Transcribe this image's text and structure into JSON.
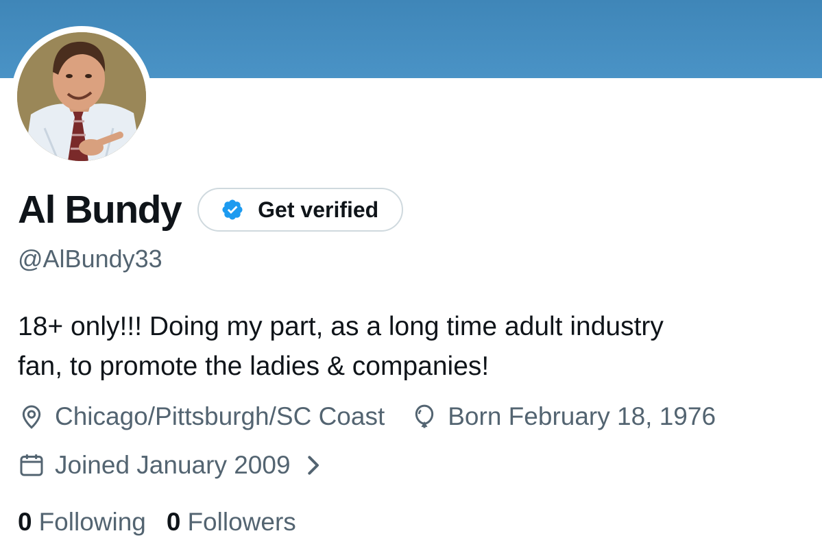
{
  "profile": {
    "display_name": "Al Bundy",
    "handle": "@AlBundy33",
    "bio_line1": "18+ only!!! Doing my part, as a long time adult industry",
    "bio_line2": "fan, to promote the ladies & companies!",
    "location": "Chicago/Pittsburgh/SC Coast",
    "birthday": "Born February 18, 1976",
    "joined": "Joined January 2009",
    "following_count": "0",
    "following_label": "Following",
    "followers_count": "0",
    "followers_label": "Followers"
  },
  "verify_button": {
    "label": "Get verified"
  },
  "icons": {
    "verified": "verified-badge-icon",
    "location": "location-pin-icon",
    "birthday": "balloon-icon",
    "joined": "calendar-icon",
    "chevron": "chevron-right-icon"
  },
  "colors": {
    "banner": "#4a93c6",
    "verified_badge": "#1d9bf0",
    "primary_text": "#0f1419",
    "secondary_text": "#536471",
    "button_border": "#cfd9de"
  }
}
